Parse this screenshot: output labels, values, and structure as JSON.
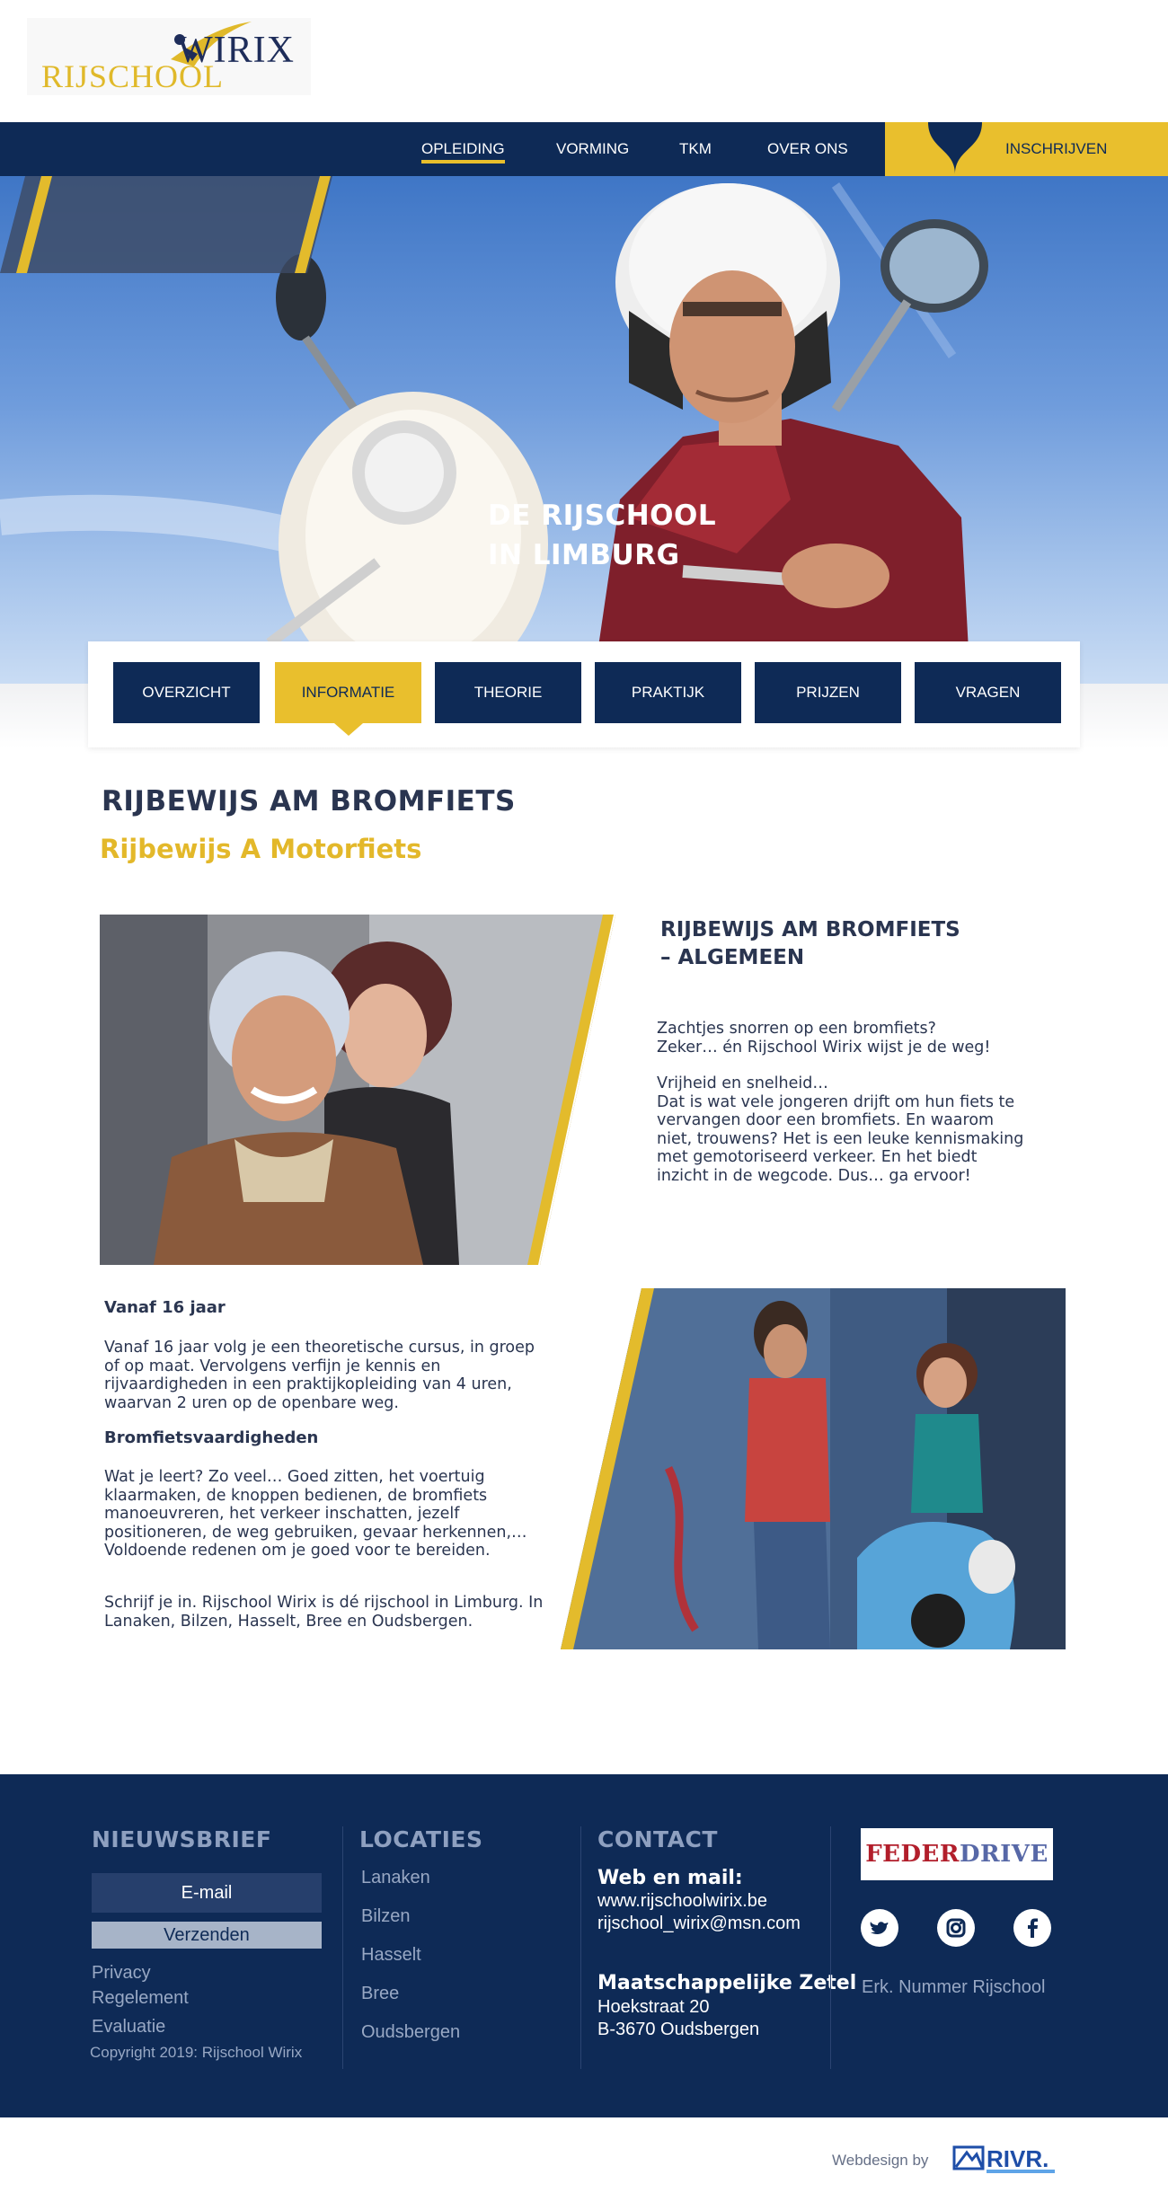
{
  "logo": {
    "word_top": "WIRIX",
    "word_bottom": "RIJSCHOOL"
  },
  "nav": {
    "items": [
      "OPLEIDING",
      "VORMING",
      "TKM",
      "OVER ONS"
    ],
    "active": "OPLEIDING",
    "signup": "INSCHRIJVEN"
  },
  "hero": {
    "title_line1": "DE RIJSCHOOL",
    "title_line2": "IN LIMBURG"
  },
  "tabs": {
    "items": [
      "OVERZICHT",
      "INFORMATIE",
      "THEORIE",
      "PRAKTIJK",
      "PRIJZEN",
      "VRAGEN"
    ],
    "active": "INFORMATIE"
  },
  "content": {
    "heading": "RIJBEWIJS AM BROMFIETS",
    "subheading": "Rijbewijs A Motorfiets",
    "section_title_line1": "RIJBEWIJS AM BROMFIETS",
    "section_title_line2": "– ALGEMEEN",
    "intro_line1": "Zachtjes snorren op een bromfiets?",
    "intro_line2": "Zeker… én Rijschool Wirix wijst je de weg!",
    "freedom_title": "Vrijheid en snelheid…",
    "freedom_text": "Dat is wat vele jongeren drijft om hun fiets te vervangen door een bromfiets. En waarom niet, trouwens? Het is een leuke kennismaking met gemotoriseerd verkeer. En het biedt inzicht in de wegcode. Dus… ga ervoor!",
    "age_title": "Vanaf 16 jaar",
    "age_text": "Vanaf 16 jaar volg je een theoretische cursus, in groep of op maat. Vervolgens verfijn je kennis en rijvaardigheden in een praktijkopleiding van 4 uren, waarvan 2 uren op de openbare weg.",
    "skills_title": "Bromfietsvaardigheden",
    "skills_text": "Wat je leert? Zo veel… Goed zitten, het voertuig klaarmaken, de knoppen bedienen, de bromfiets manoeuvreren, het verkeer inschatten, jezelf positioneren, de weg gebruiken, gevaar herkennen,… Voldoende redenen om je goed voor te bereiden.",
    "signup_text": "Schrijf je in. Rijschool Wirix is dé rijschool in Limburg. In Lanaken, Bilzen, Hasselt, Bree en Oudsbergen."
  },
  "footer": {
    "newsletter": {
      "title": "NIEUWSBRIEF",
      "email_placeholder": "E-mail",
      "send": "Verzenden",
      "links": [
        "Privacy",
        "Regelement",
        "Evaluatie"
      ],
      "copyright": "Copyright 2019: Rijschool Wirix"
    },
    "locations": {
      "title": "LOCATIES",
      "items": [
        "Lanaken",
        "Bilzen",
        "Hasselt",
        "Bree",
        "Oudsbergen"
      ]
    },
    "contact": {
      "title": "CONTACT",
      "web_title": "Web en mail:",
      "website": "www.rijschoolwirix.be",
      "email": "rijschool_wirix@msn.com",
      "seat_title": "Maatschappelijke Zetel",
      "street": "Hoekstraat 20",
      "city": "B-3670 Oudsbergen"
    },
    "partner": {
      "part1": "FEDER",
      "part2": "DRIVE"
    },
    "social": [
      "twitter-icon",
      "instagram-icon",
      "facebook-icon"
    ],
    "erk": "Erk. Nummer Rijschool"
  },
  "credit": {
    "text": "Webdesign by",
    "brand": "RIVR."
  },
  "colors": {
    "navy": "#0e2a56",
    "gold": "#e9bf2d",
    "text": "#2a3550"
  }
}
